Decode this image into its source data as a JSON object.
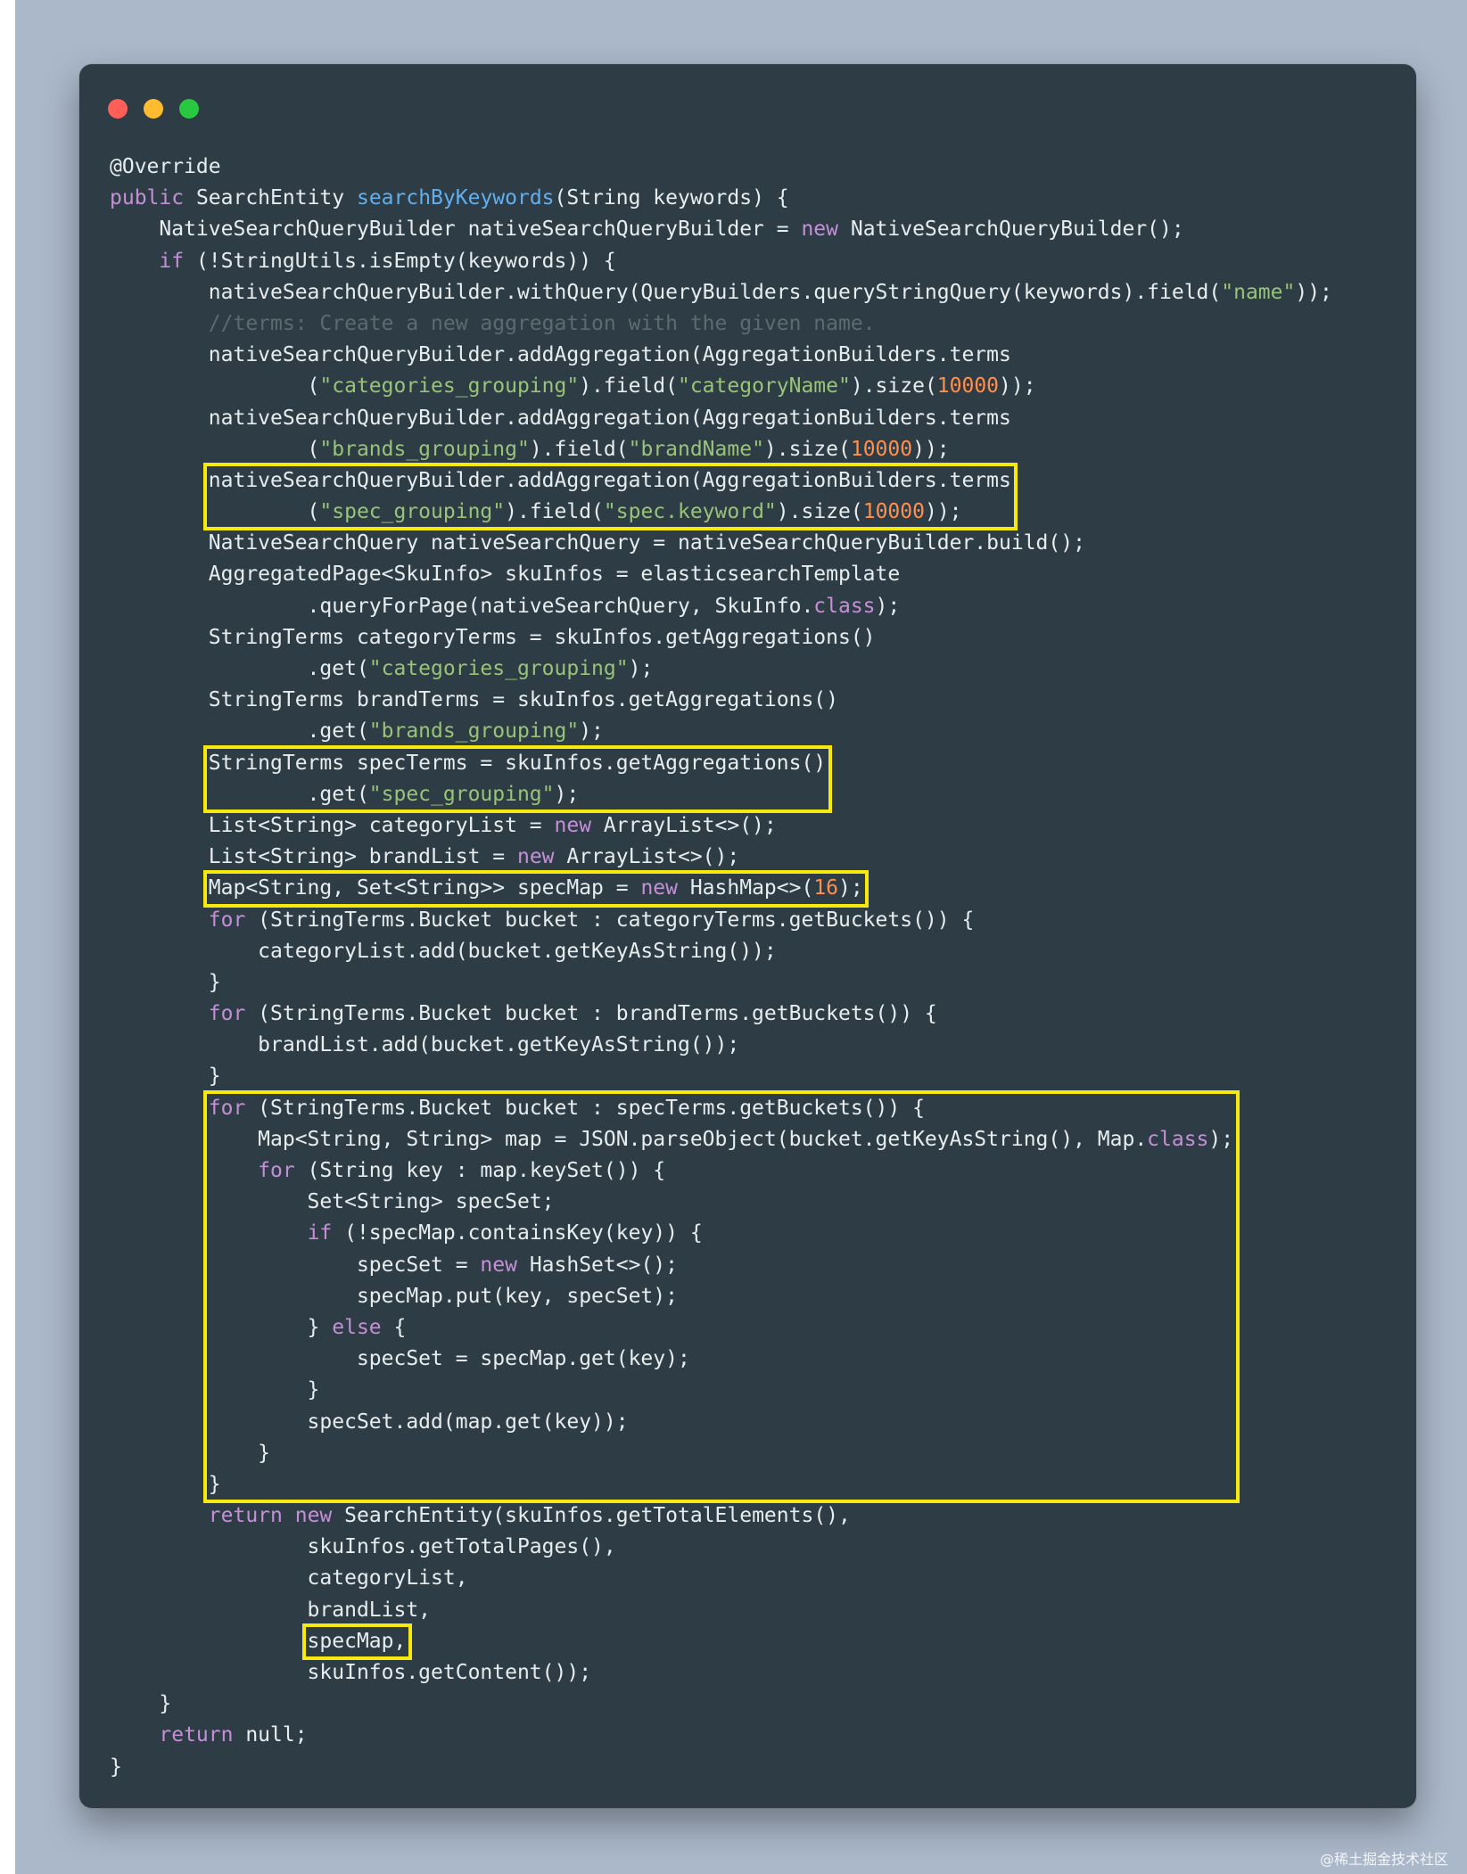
{
  "window": {
    "traffic_lights": {
      "close": "#ff5f57",
      "minimize": "#febc2e",
      "maximize": "#28c840"
    }
  },
  "colors": {
    "background": "#abb8c9",
    "editor_background": "#2e3d45",
    "text": "#e7ecef",
    "keyword": "#c58fd8",
    "string": "#98c379",
    "number": "#ff8f4e",
    "function": "#61afef",
    "comment": "#5c6b70",
    "highlight_box": "#f7e90f"
  },
  "code": {
    "language": "java",
    "lines": [
      [
        [
          "t",
          "@Override"
        ]
      ],
      [
        [
          "k",
          "public"
        ],
        [
          "t",
          " SearchEntity "
        ],
        [
          "f",
          "searchByKeywords"
        ],
        [
          "t",
          "(String keywords) {"
        ]
      ],
      [
        [
          "t",
          "    NativeSearchQueryBuilder nativeSearchQueryBuilder = "
        ],
        [
          "k",
          "new"
        ],
        [
          "t",
          " NativeSearchQueryBuilder();"
        ]
      ],
      [
        [
          "t",
          "    "
        ],
        [
          "k",
          "if"
        ],
        [
          "t",
          " (!StringUtils.isEmpty(keywords)) {"
        ]
      ],
      [
        [
          "t",
          "        nativeSearchQueryBuilder.withQuery(QueryBuilders.queryStringQuery(keywords).field("
        ],
        [
          "s",
          "\"name\""
        ],
        [
          "t",
          "));"
        ]
      ],
      [
        [
          "t",
          "        "
        ],
        [
          "c",
          "//terms: Create a new aggregation with the given name."
        ]
      ],
      [
        [
          "t",
          "        nativeSearchQueryBuilder.addAggregation(AggregationBuilders.terms"
        ]
      ],
      [
        [
          "t",
          "                ("
        ],
        [
          "s",
          "\"categories_grouping\""
        ],
        [
          "t",
          ").field("
        ],
        [
          "s",
          "\"categoryName\""
        ],
        [
          "t",
          ").size("
        ],
        [
          "n",
          "10000"
        ],
        [
          "t",
          "));"
        ]
      ],
      [
        [
          "t",
          "        nativeSearchQueryBuilder.addAggregation(AggregationBuilders.terms"
        ]
      ],
      [
        [
          "t",
          "                ("
        ],
        [
          "s",
          "\"brands_grouping\""
        ],
        [
          "t",
          ").field("
        ],
        [
          "s",
          "\"brandName\""
        ],
        [
          "t",
          ").size("
        ],
        [
          "n",
          "10000"
        ],
        [
          "t",
          "));"
        ]
      ],
      [
        [
          "t",
          "        nativeSearchQueryBuilder.addAggregation(AggregationBuilders.terms"
        ]
      ],
      [
        [
          "t",
          "                ("
        ],
        [
          "s",
          "\"spec_grouping\""
        ],
        [
          "t",
          ").field("
        ],
        [
          "s",
          "\"spec.keyword\""
        ],
        [
          "t",
          ").size("
        ],
        [
          "n",
          "10000"
        ],
        [
          "t",
          "));"
        ]
      ],
      [
        [
          "t",
          "        NativeSearchQuery nativeSearchQuery = nativeSearchQueryBuilder.build();"
        ]
      ],
      [
        [
          "t",
          "        AggregatedPage<SkuInfo> skuInfos = elasticsearchTemplate"
        ]
      ],
      [
        [
          "t",
          "                .queryForPage(nativeSearchQuery, SkuInfo."
        ],
        [
          "k",
          "class"
        ],
        [
          "t",
          ");"
        ]
      ],
      [
        [
          "t",
          "        StringTerms categoryTerms = skuInfos.getAggregations()"
        ]
      ],
      [
        [
          "t",
          "                .get("
        ],
        [
          "s",
          "\"categories_grouping\""
        ],
        [
          "t",
          ");"
        ]
      ],
      [
        [
          "t",
          "        StringTerms brandTerms = skuInfos.getAggregations()"
        ]
      ],
      [
        [
          "t",
          "                .get("
        ],
        [
          "s",
          "\"brands_grouping\""
        ],
        [
          "t",
          ");"
        ]
      ],
      [
        [
          "t",
          "        StringTerms specTerms = skuInfos.getAggregations()"
        ]
      ],
      [
        [
          "t",
          "                .get("
        ],
        [
          "s",
          "\"spec_grouping\""
        ],
        [
          "t",
          ");"
        ]
      ],
      [
        [
          "t",
          "        List<String> categoryList = "
        ],
        [
          "k",
          "new"
        ],
        [
          "t",
          " ArrayList<>();"
        ]
      ],
      [
        [
          "t",
          "        List<String> brandList = "
        ],
        [
          "k",
          "new"
        ],
        [
          "t",
          " ArrayList<>();"
        ]
      ],
      [
        [
          "t",
          "        Map<String, Set<String>> specMap = "
        ],
        [
          "k",
          "new"
        ],
        [
          "t",
          " HashMap<>("
        ],
        [
          "n",
          "16"
        ],
        [
          "t",
          ");"
        ]
      ],
      [
        [
          "t",
          "        "
        ],
        [
          "k",
          "for"
        ],
        [
          "t",
          " (StringTerms.Bucket bucket : categoryTerms.getBuckets()) {"
        ]
      ],
      [
        [
          "t",
          "            categoryList.add(bucket.getKeyAsString());"
        ]
      ],
      [
        [
          "t",
          "        }"
        ]
      ],
      [
        [
          "t",
          "        "
        ],
        [
          "k",
          "for"
        ],
        [
          "t",
          " (StringTerms.Bucket bucket : brandTerms.getBuckets()) {"
        ]
      ],
      [
        [
          "t",
          "            brandList.add(bucket.getKeyAsString());"
        ]
      ],
      [
        [
          "t",
          "        }"
        ]
      ],
      [
        [
          "t",
          "        "
        ],
        [
          "k",
          "for"
        ],
        [
          "t",
          " (StringTerms.Bucket bucket : specTerms.getBuckets()) {"
        ]
      ],
      [
        [
          "t",
          "            Map<String, String> map = JSON.parseObject(bucket.getKeyAsString(), Map."
        ],
        [
          "k",
          "class"
        ],
        [
          "t",
          ");"
        ]
      ],
      [
        [
          "t",
          "            "
        ],
        [
          "k",
          "for"
        ],
        [
          "t",
          " (String key : map.keySet()) {"
        ]
      ],
      [
        [
          "t",
          "                Set<String> specSet;"
        ]
      ],
      [
        [
          "t",
          "                "
        ],
        [
          "k",
          "if"
        ],
        [
          "t",
          " (!specMap.containsKey(key)) {"
        ]
      ],
      [
        [
          "t",
          "                    specSet = "
        ],
        [
          "k",
          "new"
        ],
        [
          "t",
          " HashSet<>();"
        ]
      ],
      [
        [
          "t",
          "                    specMap.put(key, specSet);"
        ]
      ],
      [
        [
          "t",
          "                } "
        ],
        [
          "k",
          "else"
        ],
        [
          "t",
          " {"
        ]
      ],
      [
        [
          "t",
          "                    specSet = specMap.get(key);"
        ]
      ],
      [
        [
          "t",
          "                }"
        ]
      ],
      [
        [
          "t",
          "                specSet.add(map.get(key));"
        ]
      ],
      [
        [
          "t",
          "            }"
        ]
      ],
      [
        [
          "t",
          "        }"
        ]
      ],
      [
        [
          "t",
          "        "
        ],
        [
          "k",
          "return"
        ],
        [
          "t",
          " "
        ],
        [
          "k",
          "new"
        ],
        [
          "t",
          " SearchEntity(skuInfos.getTotalElements(),"
        ]
      ],
      [
        [
          "t",
          "                skuInfos.getTotalPages(),"
        ]
      ],
      [
        [
          "t",
          "                categoryList,"
        ]
      ],
      [
        [
          "t",
          "                brandList,"
        ]
      ],
      [
        [
          "t",
          "                specMap,"
        ]
      ],
      [
        [
          "t",
          "                skuInfos.getContent());"
        ]
      ],
      [
        [
          "t",
          "    }"
        ]
      ],
      [
        [
          "t",
          "    "
        ],
        [
          "k",
          "return"
        ],
        [
          "t",
          " null;"
        ]
      ],
      [
        [
          "t",
          "}"
        ]
      ]
    ]
  },
  "highlights": [
    {
      "label": "spec-aggregation-box",
      "lines": [
        10,
        11
      ]
    },
    {
      "label": "spec-terms-box",
      "lines": [
        19,
        20
      ]
    },
    {
      "label": "spec-map-declaration-box",
      "lines": [
        23,
        23
      ]
    },
    {
      "label": "spec-loop-box",
      "lines": [
        30,
        42
      ]
    },
    {
      "label": "spec-map-argument-box",
      "lines": [
        47,
        47
      ]
    }
  ],
  "watermark": "@稀土掘金技术社区"
}
